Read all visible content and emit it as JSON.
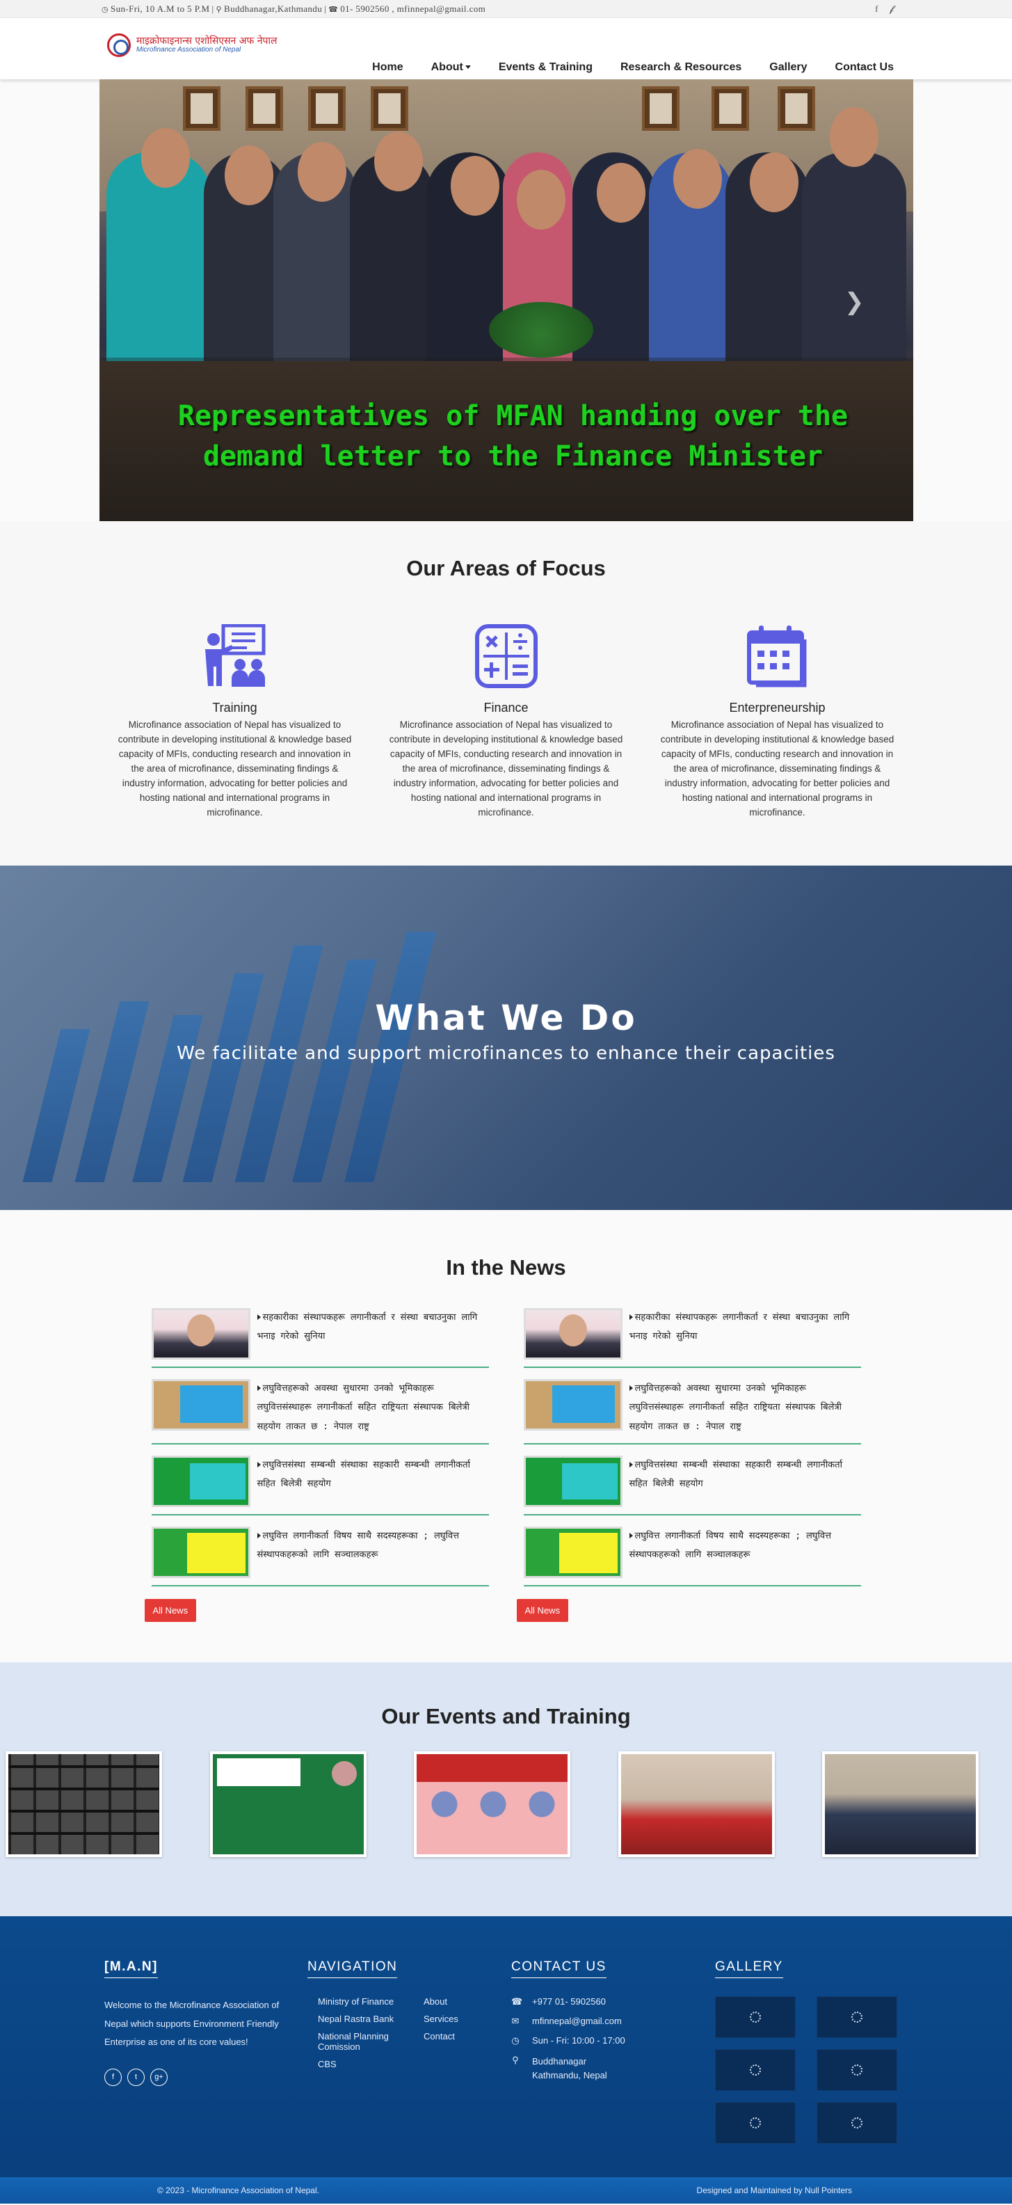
{
  "topbar": {
    "info": "Sun-Fri, 10 A.M to 5 P.M | Buddhanagar,Kathmandu | 01- 5902560 , mfinnepal@gmail.com",
    "hours": "Sun-Fri, 10 A.M to 5 P.M",
    "address": "Buddhanagar,Kathmandu",
    "phone_email": "01- 5902560 , mfinnepal@gmail.com",
    "social": [
      "facebook-icon",
      "twitter-icon"
    ]
  },
  "logo": {
    "nepali": "माइक्रोफाइनान्स एशोसिएसन अफ नेपाल",
    "english": "Microfinance Association of Nepal"
  },
  "nav": {
    "home": "Home",
    "about": "About",
    "events": "Events & Training",
    "research": "Research & Resources",
    "gallery": "Gallery",
    "contact": "Contact Us"
  },
  "hero": {
    "caption": "Representatives of MFAN handing over the demand letter to the Finance Minister",
    "next_icon": "chevron-right-icon"
  },
  "focus": {
    "title": "Our Areas of Focus",
    "items": [
      {
        "title": "Training",
        "icon": "training-icon",
        "text": "Microfinance association of Nepal has visualized to contribute in developing institutional & knowledge based capacity of MFIs, conducting research and innovation in the area of microfinance, disseminating findings & industry information, advocating for better policies and hosting national and international programs in microfinance."
      },
      {
        "title": "Finance",
        "icon": "calculator-icon",
        "text": "Microfinance association of Nepal has visualized to contribute in developing institutional & knowledge based capacity of MFIs, conducting research and innovation in the area of microfinance, disseminating findings & industry information, advocating for better policies and hosting national and international programs in microfinance."
      },
      {
        "title": "Enterpreneurship",
        "icon": "calendar-icon",
        "text": "Microfinance association of Nepal has visualized to contribute in developing institutional & knowledge based capacity of MFIs, conducting research and innovation in the area of microfinance, disseminating findings & industry information, advocating for better policies and hosting national and international programs in microfinance."
      }
    ],
    "accent": "#5b5ce0"
  },
  "whatwedo": {
    "title": "What We Do",
    "subtitle": "We facilitate and support microfinances to enhance their capacities"
  },
  "news": {
    "title": "In the News",
    "button": "All News",
    "left": [
      {
        "text": "सहकारीका संस्थापकहरू लगानीकर्ता र संस्था बचाउनुका लागि भनाइ गरेको सुनिया",
        "thumb": "t0"
      },
      {
        "text": "लघुवित्तहरूको अवस्था सुधारमा उनको भूमिकाहरू लघुवित्तसंस्थाहरू लगानीकर्ता सहित राष्ट्रियता संस्थापक बिलेत्री सहयोग ताकत छ : नेपाल राष्ट्र",
        "thumb": "t1"
      },
      {
        "text": "लघुवित्तसंस्था सम्बन्धी संस्थाका सहकारी सम्बन्धी लगानीकर्ता सहित बिलेत्री सहयोग",
        "thumb": "t2"
      },
      {
        "text": "लघुवित्त लगानीकर्ता विषय साथै सदस्यहरूका ; लघुवित्त संस्थापकहरूको लागि सञ्चालकहरू",
        "thumb": "t3"
      }
    ],
    "right": [
      {
        "text": "सहकारीका संस्थापकहरू लगानीकर्ता र संस्था बचाउनुका लागि भनाइ गरेको सुनिया",
        "thumb": "t0"
      },
      {
        "text": "लघुवित्तहरूको अवस्था सुधारमा उनको भूमिकाहरू लघुवित्तसंस्थाहरू लगानीकर्ता सहित राष्ट्रियता संस्थापक बिलेत्री सहयोग ताकत छ : नेपाल राष्ट्र",
        "thumb": "t1"
      },
      {
        "text": "लघुवित्तसंस्था सम्बन्धी संस्थाका सहकारी सम्बन्धी लगानीकर्ता सहित बिलेत्री सहयोग",
        "thumb": "t2"
      },
      {
        "text": "लघुवित्त लगानीकर्ता विषय साथै सदस्यहरूका ; लघुवित्त संस्थापकहरूको लागि सञ्चालकहरू",
        "thumb": "t3"
      }
    ],
    "divider_color": "#4cae84",
    "button_color": "#e53935"
  },
  "events": {
    "title": "Our Events and Training",
    "thumbs": [
      "ev0",
      "ev1",
      "ev2",
      "ev3",
      "ev4"
    ]
  },
  "footer": {
    "brand": "[M.A.N]",
    "about": "Welcome to the Microfinance Association of Nepal which supports Environment Friendly Enterprise as one of its core values!",
    "social": [
      "facebook-icon",
      "twitter-icon",
      "google-plus-icon"
    ],
    "nav_title": "NAVIGATION",
    "nav_links": [
      "Ministry of Finance",
      "About",
      "Nepal Rastra Bank",
      "Services",
      "National Planning Comission",
      "Contact",
      "CBS",
      ""
    ],
    "contact_title": "CONTACT US",
    "contact": {
      "phone": "+977 01- 5902560",
      "email": "mfinnepal@gmail.com",
      "hours": "Sun - Fri: 10:00 - 17:00",
      "address": "Buddhanagar Kathmandu, Nepal"
    },
    "gallery_title": "GALLERY",
    "copyright": "© 2023 - Microfinance Association of Nepal.",
    "credit": "Designed and Maintained by Null Pointers",
    "bg": "#0b4a8c"
  }
}
